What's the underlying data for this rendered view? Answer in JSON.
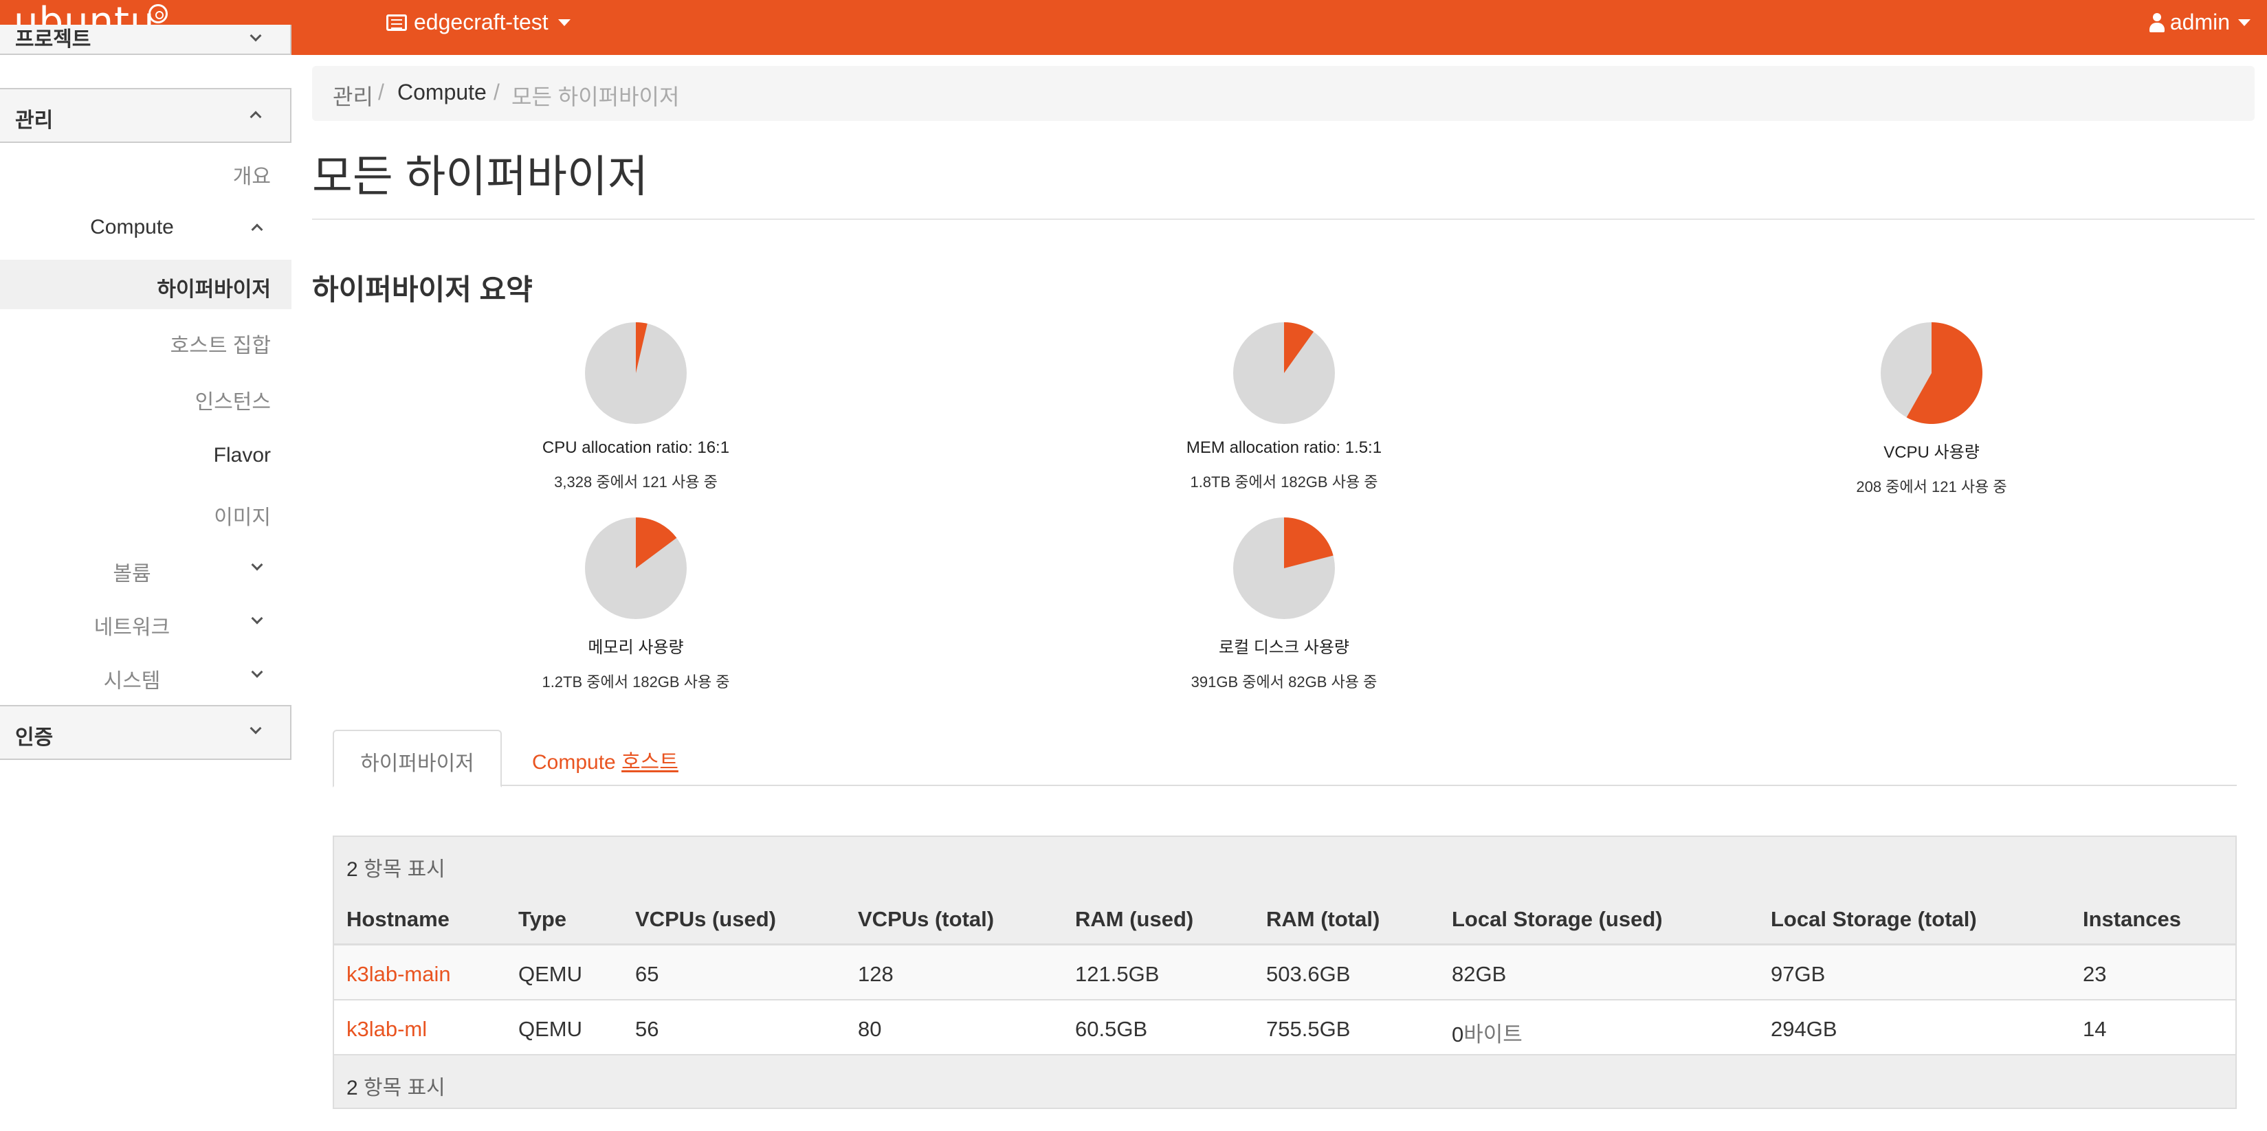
{
  "topbar": {
    "logo": "ubuntu",
    "project": "edgecraft-test",
    "user": "admin"
  },
  "sidebar": {
    "project_section": "프로젝트",
    "admin_section": "관리",
    "overview": "개요",
    "compute_group": "Compute",
    "hypervisors": "하이퍼바이저",
    "host_aggregates": "호스트 집합",
    "instances": "인스턴스",
    "flavors": "Flavor",
    "images": "이미지",
    "volumes_group": "볼륨",
    "network_group": "네트워크",
    "system_group": "시스템",
    "identity_section": "인증"
  },
  "breadcrumb": {
    "level1": "관리",
    "level2": "Compute",
    "level3": "모든 하이퍼바이저",
    "sep": "/"
  },
  "page": {
    "title": "모든 하이퍼바이저",
    "summary_title": "하이퍼바이저 요약"
  },
  "colors": {
    "accent": "#e95420",
    "pie_bg": "#d9d9d9"
  },
  "summary": [
    {
      "label": "CPU allocation ratio: 16:1",
      "detail": "3,328 중에서 121 사용 중",
      "used": 121,
      "total": 3328
    },
    {
      "label": "MEM allocation ratio: 1.5:1",
      "detail": "1.8TB 중에서 182GB 사용 중",
      "used": 182,
      "total": 1843
    },
    {
      "label": "VCPU 사용량",
      "detail": "208 중에서 121 사용 중",
      "used": 121,
      "total": 208
    },
    {
      "label": "메모리 사용량",
      "detail": "1.2TB 중에서 182GB 사용 중",
      "used": 182,
      "total": 1229
    },
    {
      "label": "로컬 디스크 사용량",
      "detail": "391GB 중에서 82GB 사용 중",
      "used": 82,
      "total": 391
    }
  ],
  "tabs": {
    "hypervisors": "하이퍼바이저",
    "compute_hosts_a": "Compute",
    "compute_hosts_b": "호스트"
  },
  "table": {
    "count_num": "2",
    "count_text": "항목 표시",
    "headers": [
      "Hostname",
      "Type",
      "VCPUs (used)",
      "VCPUs (total)",
      "RAM (used)",
      "RAM (total)",
      "Local Storage (used)",
      "Local Storage (total)",
      "Instances"
    ],
    "rows": [
      [
        "k3lab-main",
        "QEMU",
        "65",
        "128",
        "121.5GB",
        "503.6GB",
        "82GB",
        "97GB",
        "23"
      ],
      [
        "k3lab-ml",
        "QEMU",
        "56",
        "80",
        "60.5GB",
        "755.5GB",
        "0",
        "294GB",
        "14"
      ]
    ],
    "zero_unit": "바이트"
  }
}
